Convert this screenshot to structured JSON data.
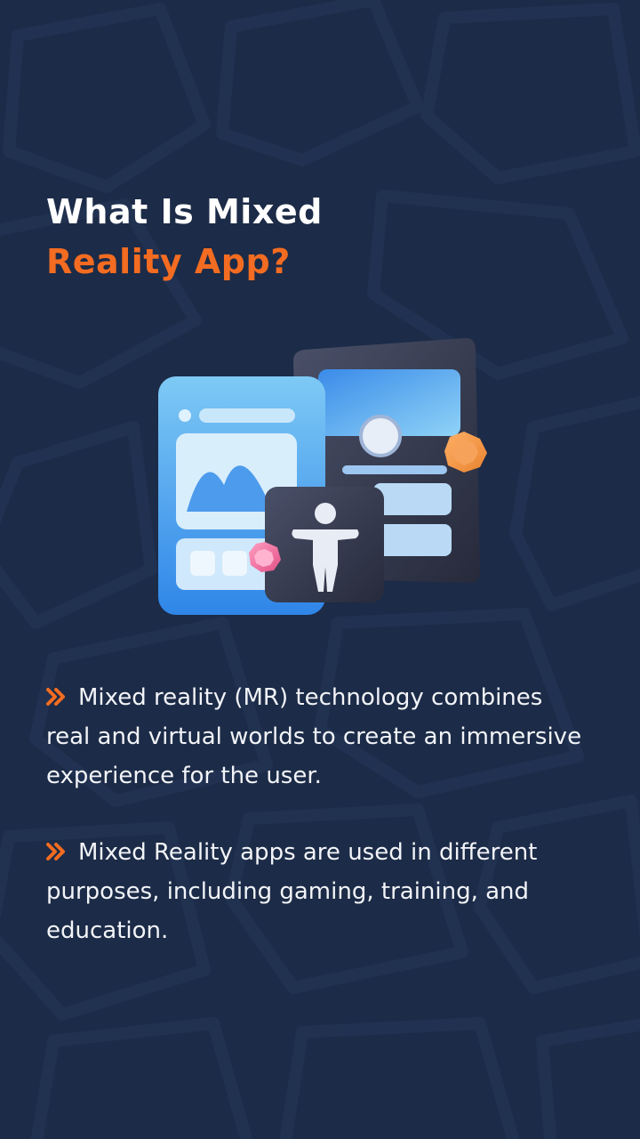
{
  "header": {
    "title_line1": "What Is Mixed",
    "title_line2": "Reality App?"
  },
  "illustration": {
    "icon": "mixed-reality-app-illustration"
  },
  "bullets": [
    {
      "icon": "double-chevron-right-icon",
      "text": "Mixed reality (MR) technology combines real and virtual worlds to create an immersive experience for the user."
    },
    {
      "icon": "double-chevron-right-icon",
      "text": "Mixed Reality apps are used in different purposes, including gaming, training, and education."
    }
  ],
  "colors": {
    "background": "#1c2b47",
    "accent": "#f36c21",
    "text": "#ffffff"
  }
}
